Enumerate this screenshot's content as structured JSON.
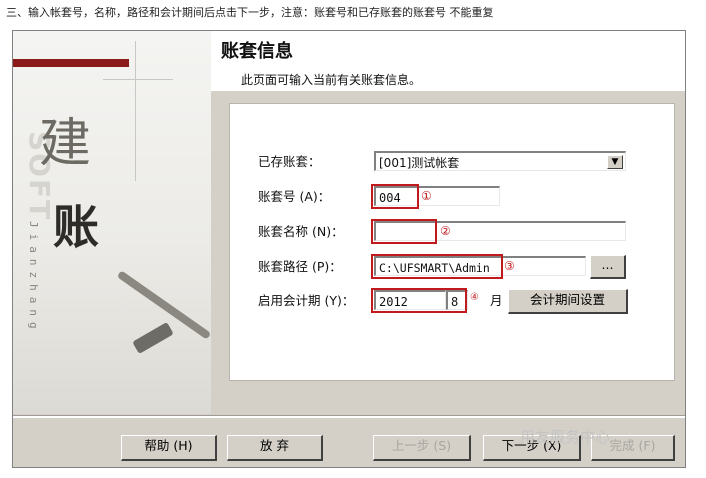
{
  "instruction": "三、输入帐套号，名称，路径和会计期间后点击下一步，注意：账套号和已存账套的账套号 不能重复",
  "header": {
    "title": "账套信息",
    "subtitle": "此页面可输入当前有关账套信息。"
  },
  "side": {
    "char_top": "建",
    "char_bottom": "账",
    "soft_text": "SOFT",
    "pinyin": "Jianzhang"
  },
  "form": {
    "existing": {
      "label": "已存账套：",
      "value": "[001]测试帐套"
    },
    "number": {
      "label": "账套号 (A)：",
      "value": "004",
      "marker": "①"
    },
    "name": {
      "label": "账套名称 (N)：",
      "value": "",
      "marker": "②"
    },
    "path": {
      "label": "账套路径 (P)：",
      "value": "C:\\UFSMART\\Admin",
      "marker": "③",
      "browse": "..."
    },
    "period": {
      "label": "启用会计期 (Y)：",
      "year": "2012",
      "month": "8",
      "marker": "④",
      "month_unit": "月",
      "setting_button": "会计期间设置"
    }
  },
  "buttons": {
    "help": "帮助 (H)",
    "cancel": "放 弃",
    "prev": "上一步 (S)",
    "next": "下一步 (X)",
    "finish": "完成 (F)"
  },
  "watermark": "用友服务中心",
  "colors": {
    "dialog_bg": "#d4d0c8",
    "highlight_red": "#c0191e",
    "side_bar": "#8b1b1b"
  }
}
